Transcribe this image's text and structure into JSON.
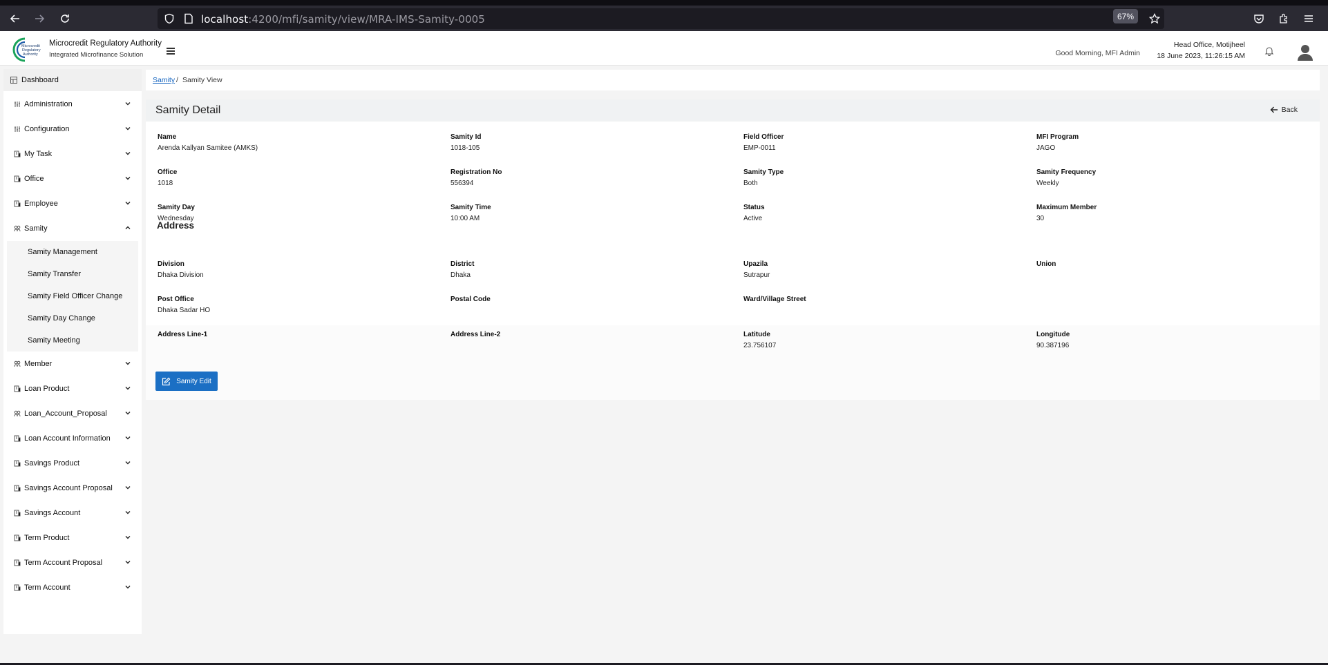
{
  "browser": {
    "url_host": "localhost",
    "url_path": ":4200/mfi/samity/view/MRA-IMS-Samity-0005",
    "zoom": "67%"
  },
  "header": {
    "org_name": "Microcredit Regulatory Authority",
    "org_subtitle": "Integrated Microfinance Solution",
    "logo_text": [
      "Microcredit",
      "Regulatory",
      "Authority"
    ],
    "greeting": "Good Morning, MFI Admin",
    "office": "Head Office, Motijheel",
    "datetime": "18 June 2023, 11:26:15 AM"
  },
  "sidebar": {
    "dashboard": "Dashboard",
    "items": [
      {
        "label": "Administration"
      },
      {
        "label": "Configuration"
      },
      {
        "label": "My Task"
      },
      {
        "label": "Office"
      },
      {
        "label": "Employee"
      },
      {
        "label": "Samity"
      },
      {
        "label": "Member"
      },
      {
        "label": "Loan Product"
      },
      {
        "label": "Loan_Account_Proposal"
      },
      {
        "label": "Loan Account Information"
      },
      {
        "label": "Savings Product"
      },
      {
        "label": "Savings Account Proposal"
      },
      {
        "label": "Savings Account"
      },
      {
        "label": "Term Product"
      },
      {
        "label": "Term Account Proposal"
      },
      {
        "label": "Term Account"
      }
    ],
    "samity_sub": [
      {
        "label": "Samity Management"
      },
      {
        "label": "Samity Transfer"
      },
      {
        "label": "Samity Field Officer Change"
      },
      {
        "label": "Samity Day Change"
      },
      {
        "label": "Samity Meeting"
      }
    ]
  },
  "breadcrumb": {
    "link": "Samity",
    "separator": "/",
    "current": "Samity View"
  },
  "detail": {
    "title": "Samity Detail",
    "back_label": "Back",
    "fields": {
      "name": {
        "label": "Name",
        "value": "Arenda Kallyan Samitee (AMKS)"
      },
      "samity_id": {
        "label": "Samity Id",
        "value": "1018-105"
      },
      "field_officer": {
        "label": "Field Officer",
        "value": "EMP-0011"
      },
      "mfi_program": {
        "label": "MFI Program",
        "value": "JAGO"
      },
      "office": {
        "label": "Office",
        "value": "1018"
      },
      "registration_no": {
        "label": "Registration No",
        "value": "556394"
      },
      "samity_type": {
        "label": "Samity Type",
        "value": "Both"
      },
      "samity_frequency": {
        "label": "Samity Frequency",
        "value": "Weekly"
      },
      "samity_day": {
        "label": "Samity Day",
        "value": "Wednesday"
      },
      "samity_time": {
        "label": "Samity Time",
        "value": "10:00 AM"
      },
      "status": {
        "label": "Status",
        "value": "Active"
      },
      "maximum_member": {
        "label": "Maximum Member",
        "value": "30"
      }
    },
    "address_title": "Address",
    "address": {
      "division": {
        "label": "Division",
        "value": "Dhaka Division"
      },
      "district": {
        "label": "District",
        "value": "Dhaka"
      },
      "upazila": {
        "label": "Upazila",
        "value": "Sutrapur"
      },
      "union": {
        "label": "Union",
        "value": ""
      },
      "post_office": {
        "label": "Post Office",
        "value": "Dhaka Sadar HO"
      },
      "postal_code": {
        "label": "Postal Code",
        "value": ""
      },
      "ward": {
        "label": "Ward/Village Street",
        "value": ""
      },
      "address_line_1": {
        "label": "Address Line-1",
        "value": ""
      },
      "address_line_2": {
        "label": "Address Line-2",
        "value": ""
      },
      "latitude": {
        "label": "Latitude",
        "value": "23.756107"
      },
      "longitude": {
        "label": "Longitude",
        "value": "90.387196"
      }
    },
    "edit_label": "Samity Edit"
  }
}
